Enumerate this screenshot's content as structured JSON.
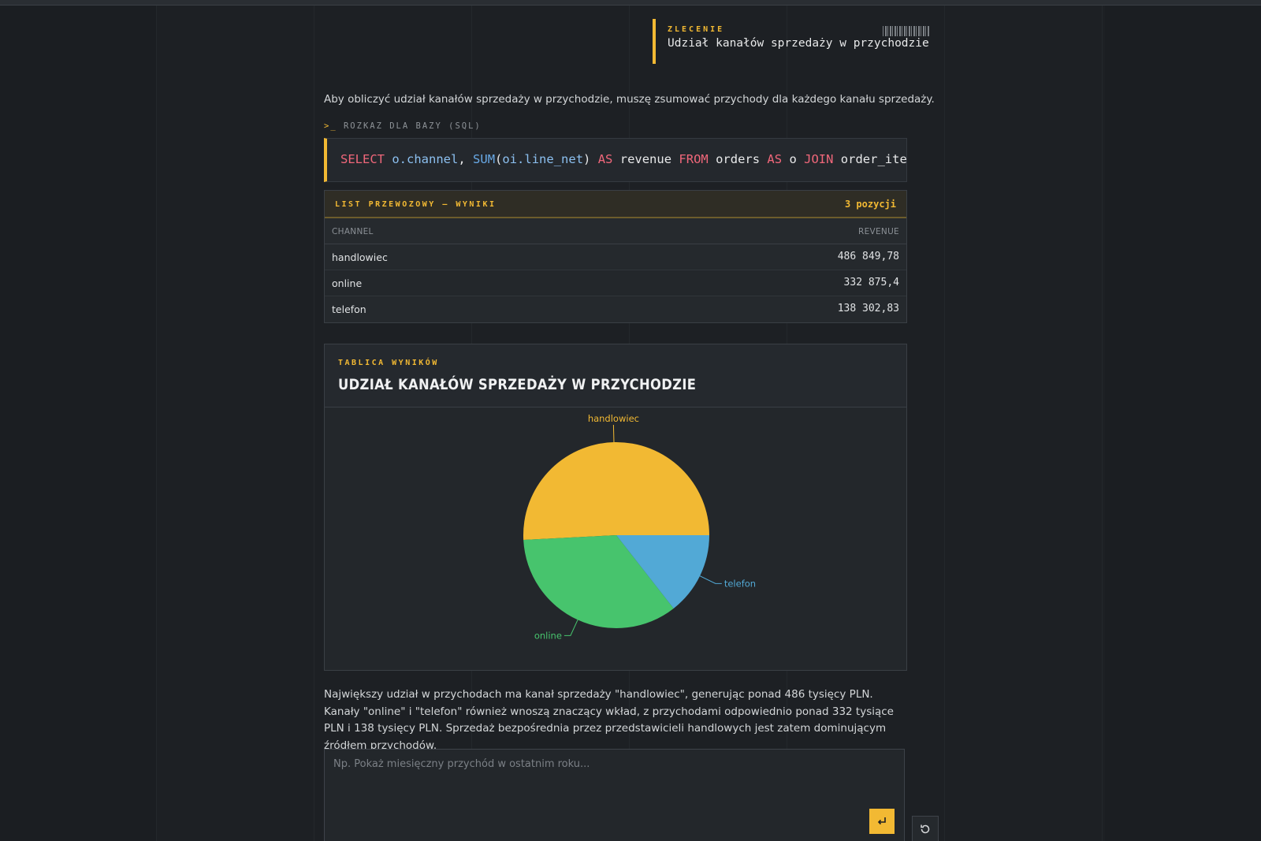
{
  "order": {
    "label": "ZLECENIE",
    "title": "Udział kanałów sprzedaży w przychodzie"
  },
  "intro": "Aby obliczyć udział kanałów sprzedaży w przychodzie, muszę zsumować przychody dla każdego kanału sprzedaży.",
  "sql": {
    "label_prompt": ">_",
    "label": "ROZKAZ DLA BAZY (SQL)",
    "tokens": [
      "SELECT",
      "o.channel",
      ",",
      "SUM",
      "(",
      "oi.line_net",
      ")",
      "AS",
      "revenue",
      "FROM",
      "orders",
      "AS",
      "o",
      "JOIN",
      "order_items"
    ]
  },
  "results": {
    "title": "LIST PRZEWOZOWY — WYNIKI",
    "count": "3 pozycji",
    "columns": [
      "CHANNEL",
      "REVENUE"
    ],
    "rows": [
      {
        "channel": "handlowiec",
        "revenue": "486 849,78"
      },
      {
        "channel": "online",
        "revenue": "332 875,4"
      },
      {
        "channel": "telefon",
        "revenue": "138 302,83"
      }
    ]
  },
  "chart_card": {
    "label": "TABLICA WYNIKÓW",
    "title": "UDZIAŁ KANAŁÓW SPRZEDAŻY W PRZYCHODZIE"
  },
  "chart_data": {
    "type": "pie",
    "categories": [
      "handlowiec",
      "online",
      "telefon"
    ],
    "values": [
      486849.78,
      332875.4,
      138302.83
    ],
    "colors": [
      "#f2b933",
      "#47c46d",
      "#52a9d6"
    ]
  },
  "summary": "Największy udział w przychodach ma kanał sprzedaży \"handlowiec\", generując ponad 486 tysięcy PLN. Kanały \"online\" i \"telefon\" również wnoszą znaczący wkład, z przychodami odpowiednio ponad 332 tysiące PLN i 138 tysięcy PLN. Sprzedaż bezpośrednia przez przedstawicieli handlowych jest zatem dominującym źródłem przychodów.",
  "input": {
    "placeholder": "Np. Pokaż miesięczny przychód w ostatnim roku..."
  },
  "icons": {
    "send": "enter-icon",
    "reset": "refresh-icon"
  }
}
